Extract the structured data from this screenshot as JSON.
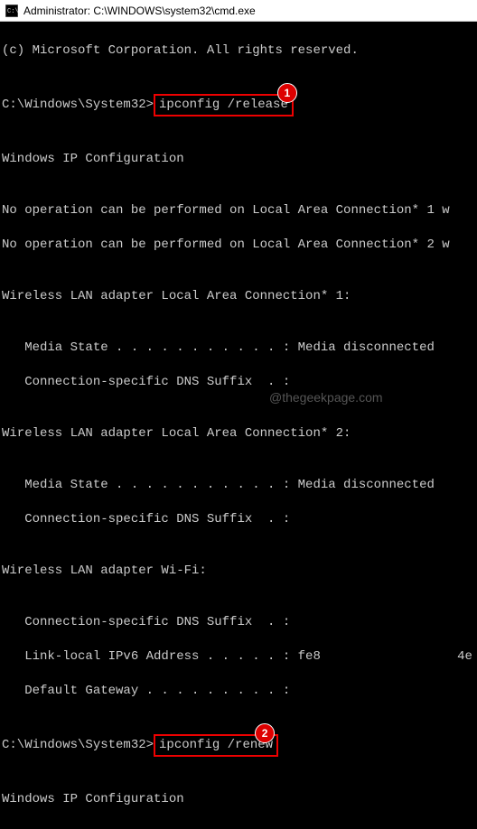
{
  "title_bar": {
    "title": "Administrator: C:\\WINDOWS\\system32\\cmd.exe"
  },
  "terminal": {
    "copyright": "(c) Microsoft Corporation. All rights reserved.",
    "prompt1_path": "C:\\Windows\\System32>",
    "command1": "ipconfig /release",
    "badge1": "1",
    "blank": "",
    "header1": "Windows IP Configuration",
    "noop1": "No operation can be performed on Local Area Connection* 1 w",
    "noop2": "No operation can be performed on Local Area Connection* 2 w",
    "adapter1_title": "Wireless LAN adapter Local Area Connection* 1:",
    "adapter1_media": "   Media State . . . . . . . . . . . : Media disconnected",
    "adapter1_dns": "   Connection-specific DNS Suffix  . :",
    "adapter2_title": "Wireless LAN adapter Local Area Connection* 2:",
    "adapter2_media": "   Media State . . . . . . . . . . . : Media disconnected",
    "adapter2_dns": "   Connection-specific DNS Suffix  . :",
    "wifi_title": "Wireless LAN adapter Wi-Fi:",
    "wifi_dns": "   Connection-specific DNS Suffix  . :",
    "wifi_ipv6_a": "   Link-local IPv6 Address . . . . . : fe8",
    "wifi_ipv6_b": "4e",
    "wifi_gw": "   Default Gateway . . . . . . . . . :",
    "prompt2_path": "C:\\Windows\\System32>",
    "command2": "ipconfig /renew",
    "badge2": "2",
    "header2": "Windows IP Configuration"
  },
  "watermark": "@thegeekpage.com"
}
